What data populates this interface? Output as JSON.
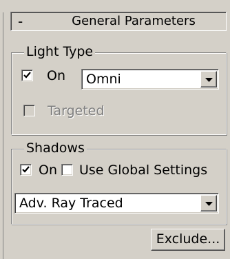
{
  "rollout": {
    "toggle_symbol": "-",
    "title": "General Parameters"
  },
  "light_type": {
    "group_label": "Light Type",
    "on_checked": true,
    "on_label": "On",
    "type_value": "Omni",
    "targeted_checked": false,
    "targeted_enabled": false,
    "targeted_label": "Targeted"
  },
  "shadows": {
    "group_label": "Shadows",
    "on_checked": true,
    "on_label": "On",
    "use_global_checked": false,
    "use_global_label": "Use Global Settings",
    "type_value": "Adv. Ray Traced",
    "exclude_label": "Exclude..."
  },
  "colors": {
    "panel_background": "#d4d0c8",
    "field_background": "#ffffff",
    "disabled_text": "#808080"
  }
}
